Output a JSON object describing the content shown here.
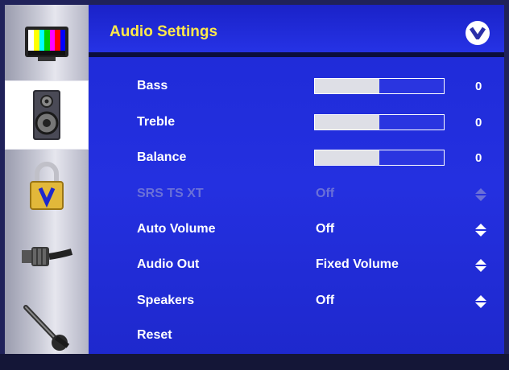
{
  "header": {
    "title": "Audio Settings",
    "logo_icon": "vizio-v-logo-icon"
  },
  "sidebar": {
    "tabs": [
      {
        "name": "picture-tab",
        "icon": "tv-color-bars-icon",
        "active": false
      },
      {
        "name": "audio-tab",
        "icon": "speaker-icon",
        "active": true
      },
      {
        "name": "parental-lock-tab",
        "icon": "padlock-icon",
        "active": false
      },
      {
        "name": "tv-connection-tab",
        "icon": "cable-connector-icon",
        "active": false
      },
      {
        "name": "setup-tab",
        "icon": "wrench-icon",
        "active": false
      }
    ]
  },
  "settings": [
    {
      "label": "Bass",
      "type": "slider",
      "value": "0",
      "fill": 0.5,
      "enabled": true
    },
    {
      "label": "Treble",
      "type": "slider",
      "value": "0",
      "fill": 0.5,
      "enabled": true
    },
    {
      "label": "Balance",
      "type": "slider",
      "value": "0",
      "fill": 0.5,
      "enabled": true
    },
    {
      "label": "SRS TS XT",
      "type": "option",
      "value": "Off",
      "enabled": false
    },
    {
      "label": "Auto Volume",
      "type": "option",
      "value": "Off",
      "enabled": true
    },
    {
      "label": "Audio Out",
      "type": "option",
      "value": "Fixed Volume",
      "enabled": true
    },
    {
      "label": "Speakers",
      "type": "option",
      "value": "Off",
      "enabled": true
    },
    {
      "label": "Reset",
      "type": "action",
      "value": "",
      "enabled": true
    }
  ],
  "colors": {
    "panel": "#2430e0",
    "title": "#ffe94a",
    "text": "#ffffff",
    "disabled": "#6a70d8",
    "slider_fill": "#dedfe6"
  }
}
